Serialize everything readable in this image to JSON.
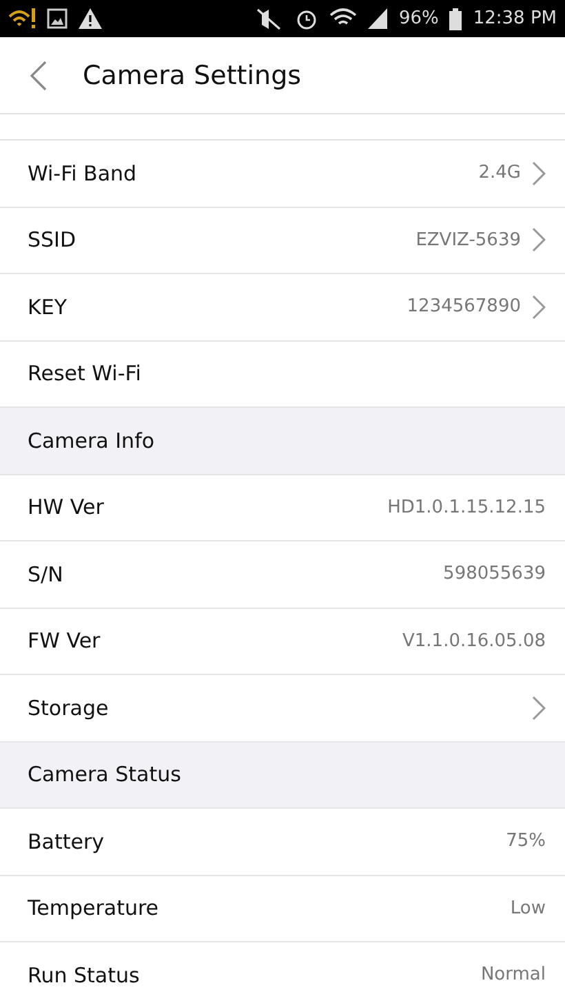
{
  "status_bar": {
    "battery": "96%",
    "time": "12:38 PM"
  },
  "header": {
    "title": "Camera Settings"
  },
  "items": [
    {
      "kind": "row",
      "label": "Wi-Fi Band",
      "value": "2.4G",
      "chevron": true
    },
    {
      "kind": "row",
      "label": "SSID",
      "value": "EZVIZ-5639",
      "chevron": true
    },
    {
      "kind": "row",
      "label": "KEY",
      "value": "1234567890",
      "chevron": true
    },
    {
      "kind": "row",
      "label": "Reset Wi-Fi",
      "chevron": false
    },
    {
      "kind": "section",
      "label": "Camera Info"
    },
    {
      "kind": "row",
      "label": "HW Ver",
      "value": "HD1.0.1.15.12.15",
      "chevron": false
    },
    {
      "kind": "row",
      "label": "S/N",
      "value": "598055639",
      "chevron": false
    },
    {
      "kind": "row",
      "label": "FW Ver",
      "value": "V1.1.0.16.05.08",
      "chevron": false
    },
    {
      "kind": "row",
      "label": "Storage",
      "chevron": true
    },
    {
      "kind": "section",
      "label": "Camera Status"
    },
    {
      "kind": "row",
      "label": "Battery",
      "value": "75%",
      "chevron": false
    },
    {
      "kind": "row",
      "label": "Temperature",
      "value": "Low",
      "chevron": false
    },
    {
      "kind": "row",
      "label": "Run Status",
      "value": "Normal",
      "chevron": false
    }
  ]
}
